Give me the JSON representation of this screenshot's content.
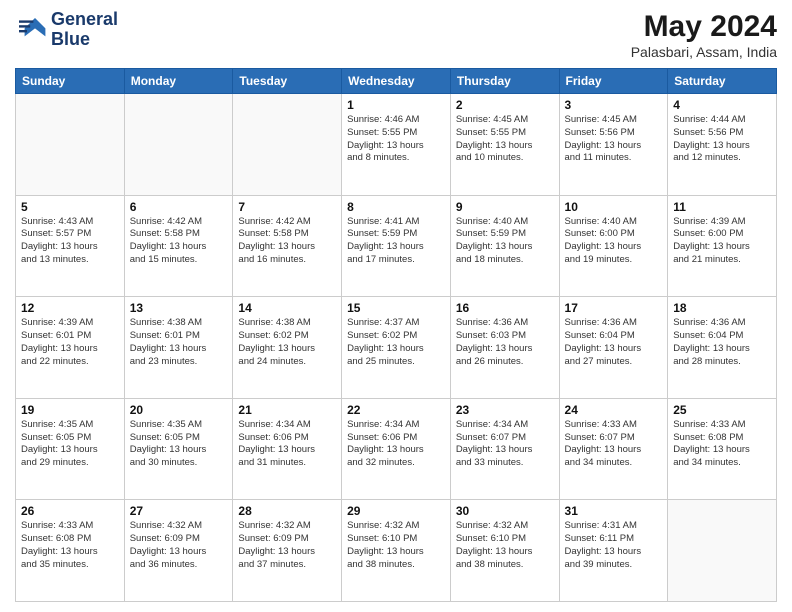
{
  "header": {
    "logo_line1": "General",
    "logo_line2": "Blue",
    "month": "May 2024",
    "location": "Palasbari, Assam, India"
  },
  "days_of_week": [
    "Sunday",
    "Monday",
    "Tuesday",
    "Wednesday",
    "Thursday",
    "Friday",
    "Saturday"
  ],
  "weeks": [
    [
      {
        "day": "",
        "info": ""
      },
      {
        "day": "",
        "info": ""
      },
      {
        "day": "",
        "info": ""
      },
      {
        "day": "1",
        "info": "Sunrise: 4:46 AM\nSunset: 5:55 PM\nDaylight: 13 hours\nand 8 minutes."
      },
      {
        "day": "2",
        "info": "Sunrise: 4:45 AM\nSunset: 5:55 PM\nDaylight: 13 hours\nand 10 minutes."
      },
      {
        "day": "3",
        "info": "Sunrise: 4:45 AM\nSunset: 5:56 PM\nDaylight: 13 hours\nand 11 minutes."
      },
      {
        "day": "4",
        "info": "Sunrise: 4:44 AM\nSunset: 5:56 PM\nDaylight: 13 hours\nand 12 minutes."
      }
    ],
    [
      {
        "day": "5",
        "info": "Sunrise: 4:43 AM\nSunset: 5:57 PM\nDaylight: 13 hours\nand 13 minutes."
      },
      {
        "day": "6",
        "info": "Sunrise: 4:42 AM\nSunset: 5:58 PM\nDaylight: 13 hours\nand 15 minutes."
      },
      {
        "day": "7",
        "info": "Sunrise: 4:42 AM\nSunset: 5:58 PM\nDaylight: 13 hours\nand 16 minutes."
      },
      {
        "day": "8",
        "info": "Sunrise: 4:41 AM\nSunset: 5:59 PM\nDaylight: 13 hours\nand 17 minutes."
      },
      {
        "day": "9",
        "info": "Sunrise: 4:40 AM\nSunset: 5:59 PM\nDaylight: 13 hours\nand 18 minutes."
      },
      {
        "day": "10",
        "info": "Sunrise: 4:40 AM\nSunset: 6:00 PM\nDaylight: 13 hours\nand 19 minutes."
      },
      {
        "day": "11",
        "info": "Sunrise: 4:39 AM\nSunset: 6:00 PM\nDaylight: 13 hours\nand 21 minutes."
      }
    ],
    [
      {
        "day": "12",
        "info": "Sunrise: 4:39 AM\nSunset: 6:01 PM\nDaylight: 13 hours\nand 22 minutes."
      },
      {
        "day": "13",
        "info": "Sunrise: 4:38 AM\nSunset: 6:01 PM\nDaylight: 13 hours\nand 23 minutes."
      },
      {
        "day": "14",
        "info": "Sunrise: 4:38 AM\nSunset: 6:02 PM\nDaylight: 13 hours\nand 24 minutes."
      },
      {
        "day": "15",
        "info": "Sunrise: 4:37 AM\nSunset: 6:02 PM\nDaylight: 13 hours\nand 25 minutes."
      },
      {
        "day": "16",
        "info": "Sunrise: 4:36 AM\nSunset: 6:03 PM\nDaylight: 13 hours\nand 26 minutes."
      },
      {
        "day": "17",
        "info": "Sunrise: 4:36 AM\nSunset: 6:04 PM\nDaylight: 13 hours\nand 27 minutes."
      },
      {
        "day": "18",
        "info": "Sunrise: 4:36 AM\nSunset: 6:04 PM\nDaylight: 13 hours\nand 28 minutes."
      }
    ],
    [
      {
        "day": "19",
        "info": "Sunrise: 4:35 AM\nSunset: 6:05 PM\nDaylight: 13 hours\nand 29 minutes."
      },
      {
        "day": "20",
        "info": "Sunrise: 4:35 AM\nSunset: 6:05 PM\nDaylight: 13 hours\nand 30 minutes."
      },
      {
        "day": "21",
        "info": "Sunrise: 4:34 AM\nSunset: 6:06 PM\nDaylight: 13 hours\nand 31 minutes."
      },
      {
        "day": "22",
        "info": "Sunrise: 4:34 AM\nSunset: 6:06 PM\nDaylight: 13 hours\nand 32 minutes."
      },
      {
        "day": "23",
        "info": "Sunrise: 4:34 AM\nSunset: 6:07 PM\nDaylight: 13 hours\nand 33 minutes."
      },
      {
        "day": "24",
        "info": "Sunrise: 4:33 AM\nSunset: 6:07 PM\nDaylight: 13 hours\nand 34 minutes."
      },
      {
        "day": "25",
        "info": "Sunrise: 4:33 AM\nSunset: 6:08 PM\nDaylight: 13 hours\nand 34 minutes."
      }
    ],
    [
      {
        "day": "26",
        "info": "Sunrise: 4:33 AM\nSunset: 6:08 PM\nDaylight: 13 hours\nand 35 minutes."
      },
      {
        "day": "27",
        "info": "Sunrise: 4:32 AM\nSunset: 6:09 PM\nDaylight: 13 hours\nand 36 minutes."
      },
      {
        "day": "28",
        "info": "Sunrise: 4:32 AM\nSunset: 6:09 PM\nDaylight: 13 hours\nand 37 minutes."
      },
      {
        "day": "29",
        "info": "Sunrise: 4:32 AM\nSunset: 6:10 PM\nDaylight: 13 hours\nand 38 minutes."
      },
      {
        "day": "30",
        "info": "Sunrise: 4:32 AM\nSunset: 6:10 PM\nDaylight: 13 hours\nand 38 minutes."
      },
      {
        "day": "31",
        "info": "Sunrise: 4:31 AM\nSunset: 6:11 PM\nDaylight: 13 hours\nand 39 minutes."
      },
      {
        "day": "",
        "info": ""
      }
    ]
  ]
}
